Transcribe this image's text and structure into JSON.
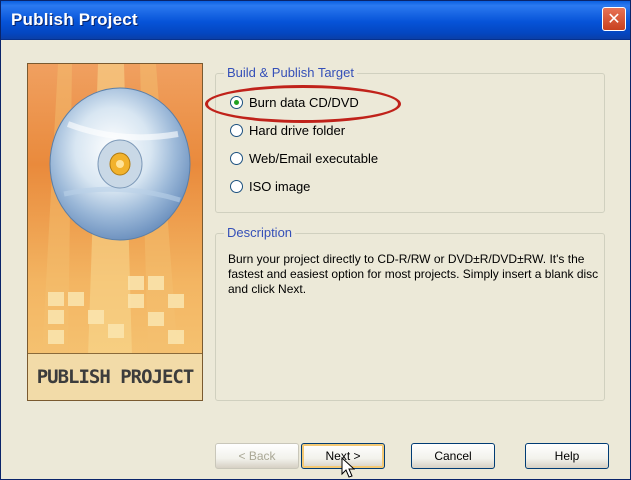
{
  "window": {
    "title": "Publish Project",
    "close_glyph": "✕"
  },
  "banner": {
    "label": "PUBLISH PROJECT",
    "icon": "cd-disc"
  },
  "target_group": {
    "legend": "Build & Publish Target",
    "options": [
      {
        "label": "Burn data CD/DVD",
        "selected": true
      },
      {
        "label": "Hard drive folder",
        "selected": false
      },
      {
        "label": "Web/Email executable",
        "selected": false
      },
      {
        "label": "ISO image",
        "selected": false
      }
    ]
  },
  "description_group": {
    "legend": "Description",
    "text": "Burn your project directly to CD-R/RW or DVD±R/DVD±RW. It's the fastest and easiest option for most projects. Simply insert a blank disc and click Next."
  },
  "buttons": {
    "back": "< Back",
    "next": "Next >",
    "cancel": "Cancel",
    "help": "Help"
  },
  "colors": {
    "title_bar": "#0653D8",
    "highlight": "#C0221A",
    "legend": "#3550B8"
  }
}
